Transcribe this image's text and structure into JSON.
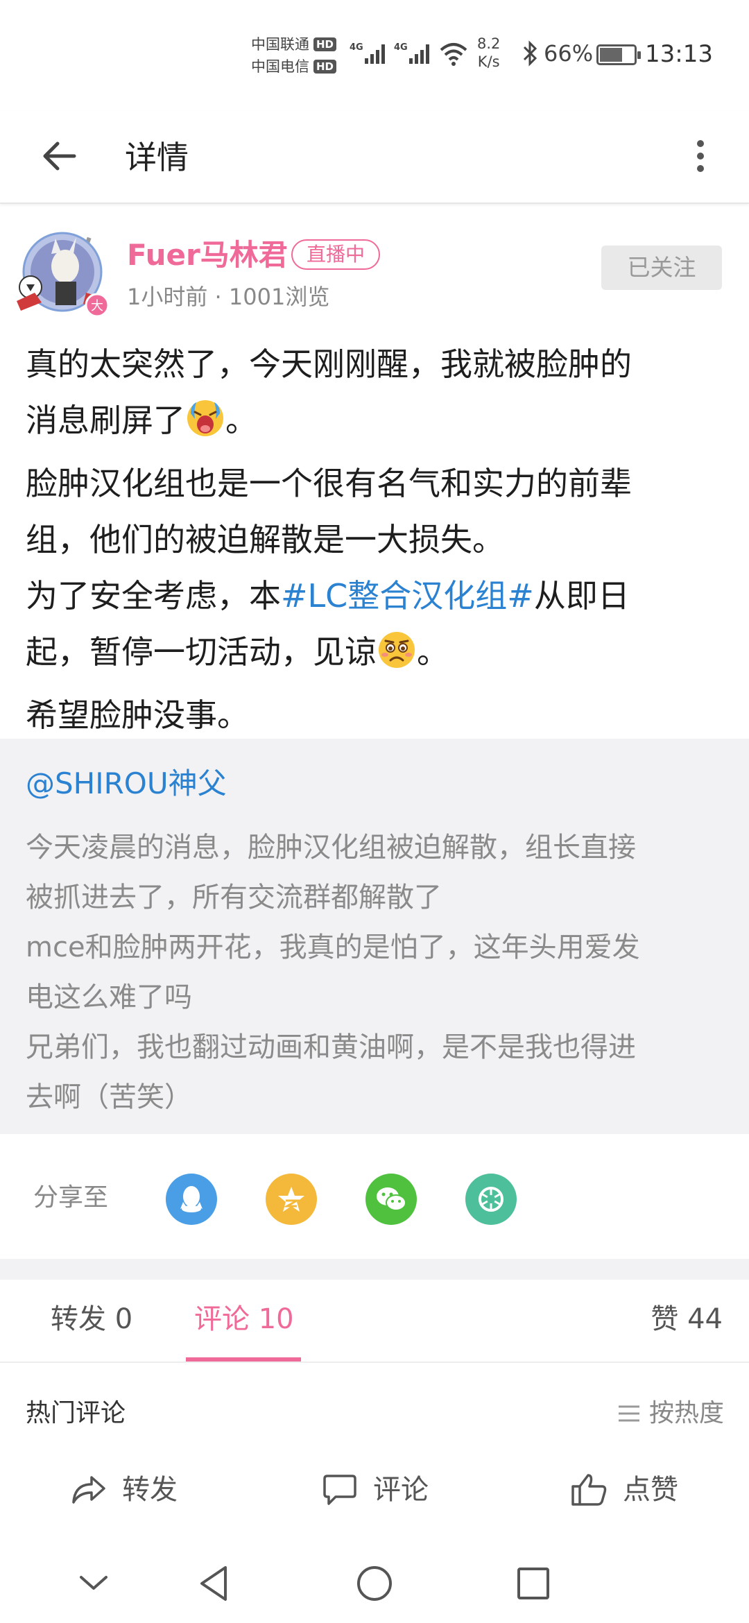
{
  "status_bar": {
    "carrier_1": "中国联通",
    "carrier_2": "中国电信",
    "hd_label": "HD",
    "network_label": "4G",
    "speed_value": "8.2",
    "speed_unit": "K/s",
    "battery_pct": "66%",
    "battery_level": 0.66,
    "time": "13:13"
  },
  "header": {
    "title": "详情",
    "back_icon": "arrow-left-icon",
    "more_icon": "more-vertical-icon"
  },
  "author": {
    "name": "Fuer马林君",
    "live_badge": "直播中",
    "avatar_badge": "大",
    "meta": "1小时前 · 1001浏览",
    "follow_label": "已关注"
  },
  "post": {
    "line1": "真的太突然了，今天刚刚醒，我就被脸肿的",
    "line2_a": "消息刷屏了",
    "line2_b": "。",
    "line3": "脸肿汉化组也是一个很有名气和实力的前辈",
    "line4": "组，他们的被迫解散是一大损失。",
    "line5_a": "为了安全考虑，本",
    "line5_hashtag": "#LC整合汉化组#",
    "line5_b": "从即日",
    "line6_a": "起，暂停一切活动，见谅",
    "line6_b": "。",
    "line7": "希望脸肿没事。"
  },
  "quote": {
    "user": "@SHIROU神父",
    "lines": [
      "今天凌晨的消息，脸肿汉化组被迫解散，组长直接",
      "被抓进去了，所有交流群都解散了",
      "mce和脸肿两开花，我真的是怕了，这年头用爱发",
      "电这么难了吗",
      "兄弟们，我也翻过动画和黄油啊，是不是我也得进",
      "去啊（苦笑）"
    ]
  },
  "share": {
    "label": "分享至",
    "targets": [
      {
        "icon": "qq-icon",
        "color": "#4a9ee6"
      },
      {
        "icon": "qzone-icon",
        "color": "#f4b93a"
      },
      {
        "icon": "wechat-icon",
        "color": "#4fc13e"
      },
      {
        "icon": "moments-icon",
        "color": "#4dbf9a"
      }
    ]
  },
  "tabs": {
    "forward": "转发 0",
    "comment": "评论 10",
    "like": "赞 44"
  },
  "comments": {
    "hot_label": "热门评论",
    "sort_label": "按热度"
  },
  "actions": {
    "forward": "转发",
    "comment": "评论",
    "like": "点赞"
  },
  "colors": {
    "accent": "#f06a99",
    "link": "#2a82d1"
  }
}
